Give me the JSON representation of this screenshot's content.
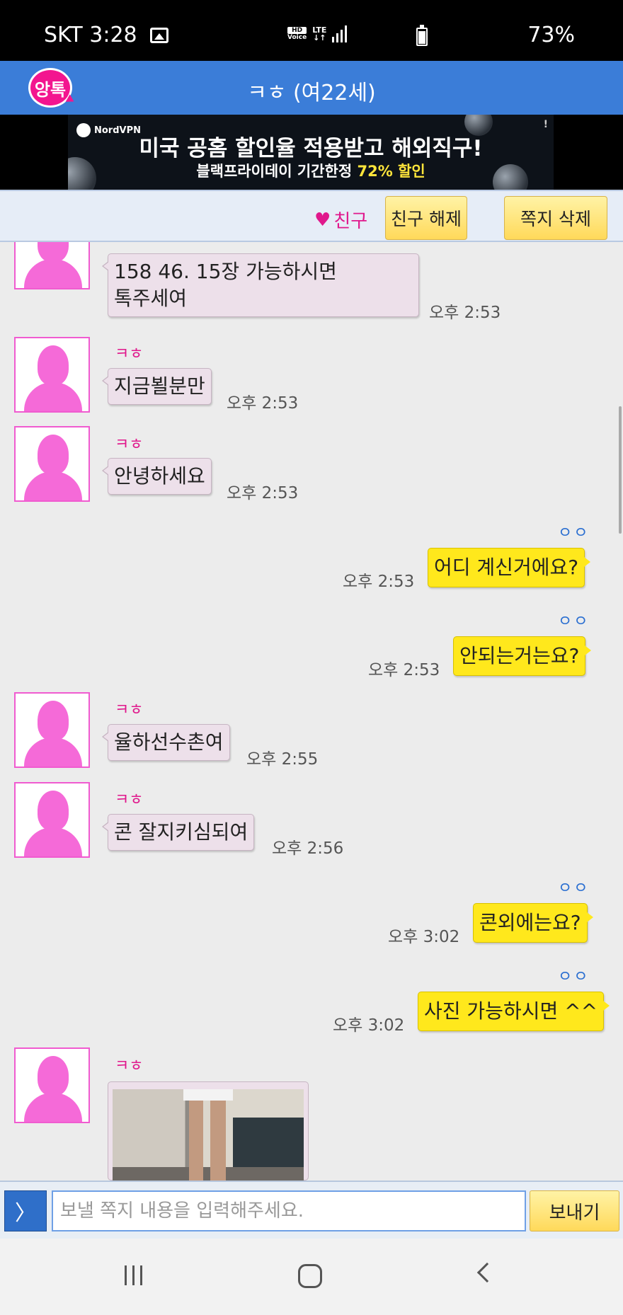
{
  "status": {
    "carrier_time": "SKT 3:28",
    "hd": "HD",
    "voice": "Voice",
    "lte": "LTE",
    "battery": "73%"
  },
  "header": {
    "logo": "앙톡",
    "title": "ㅋㅎ (여22세)"
  },
  "ad": {
    "brand": "NordVPN",
    "line1": "미국 공홈 할인율 적용받고 해외직구!",
    "line2_prefix": "블랙프라이데이 기간한정 ",
    "line2_highlight": "72% 할인",
    "info": "!"
  },
  "friendbar": {
    "heart": "♥",
    "friend_label": "친구",
    "unfriend_button": "친구 해제",
    "delete_button": "쪽지 삭제"
  },
  "messages": [
    {
      "direction": "in",
      "sender": "ㅋㅎ",
      "text": "158 46.   15장 가능하시면\n톡주세여",
      "time": "오후 2:53"
    },
    {
      "direction": "in",
      "sender": "ㅋㅎ",
      "text": "지금뵐분만",
      "time": "오후 2:53"
    },
    {
      "direction": "in",
      "sender": "ㅋㅎ",
      "text": "안녕하세요",
      "time": "오후 2:53"
    },
    {
      "direction": "out",
      "read": "ㅇㅇ",
      "text": "어디 계신거에요?",
      "time": "오후 2:53"
    },
    {
      "direction": "out",
      "read": "ㅇㅇ",
      "text": "안되는거는요?",
      "time": "오후 2:53"
    },
    {
      "direction": "in",
      "sender": "ㅋㅎ",
      "text": "율하선수촌여",
      "time": "오후 2:55"
    },
    {
      "direction": "in",
      "sender": "ㅋㅎ",
      "text": "콘 잘지키심되여",
      "time": "오후 2:56"
    },
    {
      "direction": "out",
      "read": "ㅇㅇ",
      "text": "콘외에는요?",
      "time": "오후 3:02"
    },
    {
      "direction": "out",
      "read": "ㅇㅇ",
      "text": "사진 가능하시면 ^^",
      "time": "오후 3:02"
    },
    {
      "direction": "in",
      "sender": "ㅋㅎ",
      "text": "",
      "time": "",
      "photo": true
    }
  ],
  "input": {
    "toggle": "〉",
    "placeholder": "보낼 쪽지 내용을 입력해주세요.",
    "send_button": "보내기"
  },
  "icons": {
    "status_image": "image-icon",
    "signal": "signal-icon",
    "battery": "battery-icon",
    "heart": "heart-icon",
    "avatar": "female-avatar-icon",
    "nav_recent": "recent-apps-icon",
    "nav_home": "home-icon",
    "nav_back": "back-icon"
  },
  "colors": {
    "header_blue": "#3b7dd8",
    "outgoing_bubble": "#ffe81c",
    "incoming_bubble": "#ede0ea",
    "accent_pink": "#e0188c",
    "read_blue": "#2b6fd1"
  }
}
